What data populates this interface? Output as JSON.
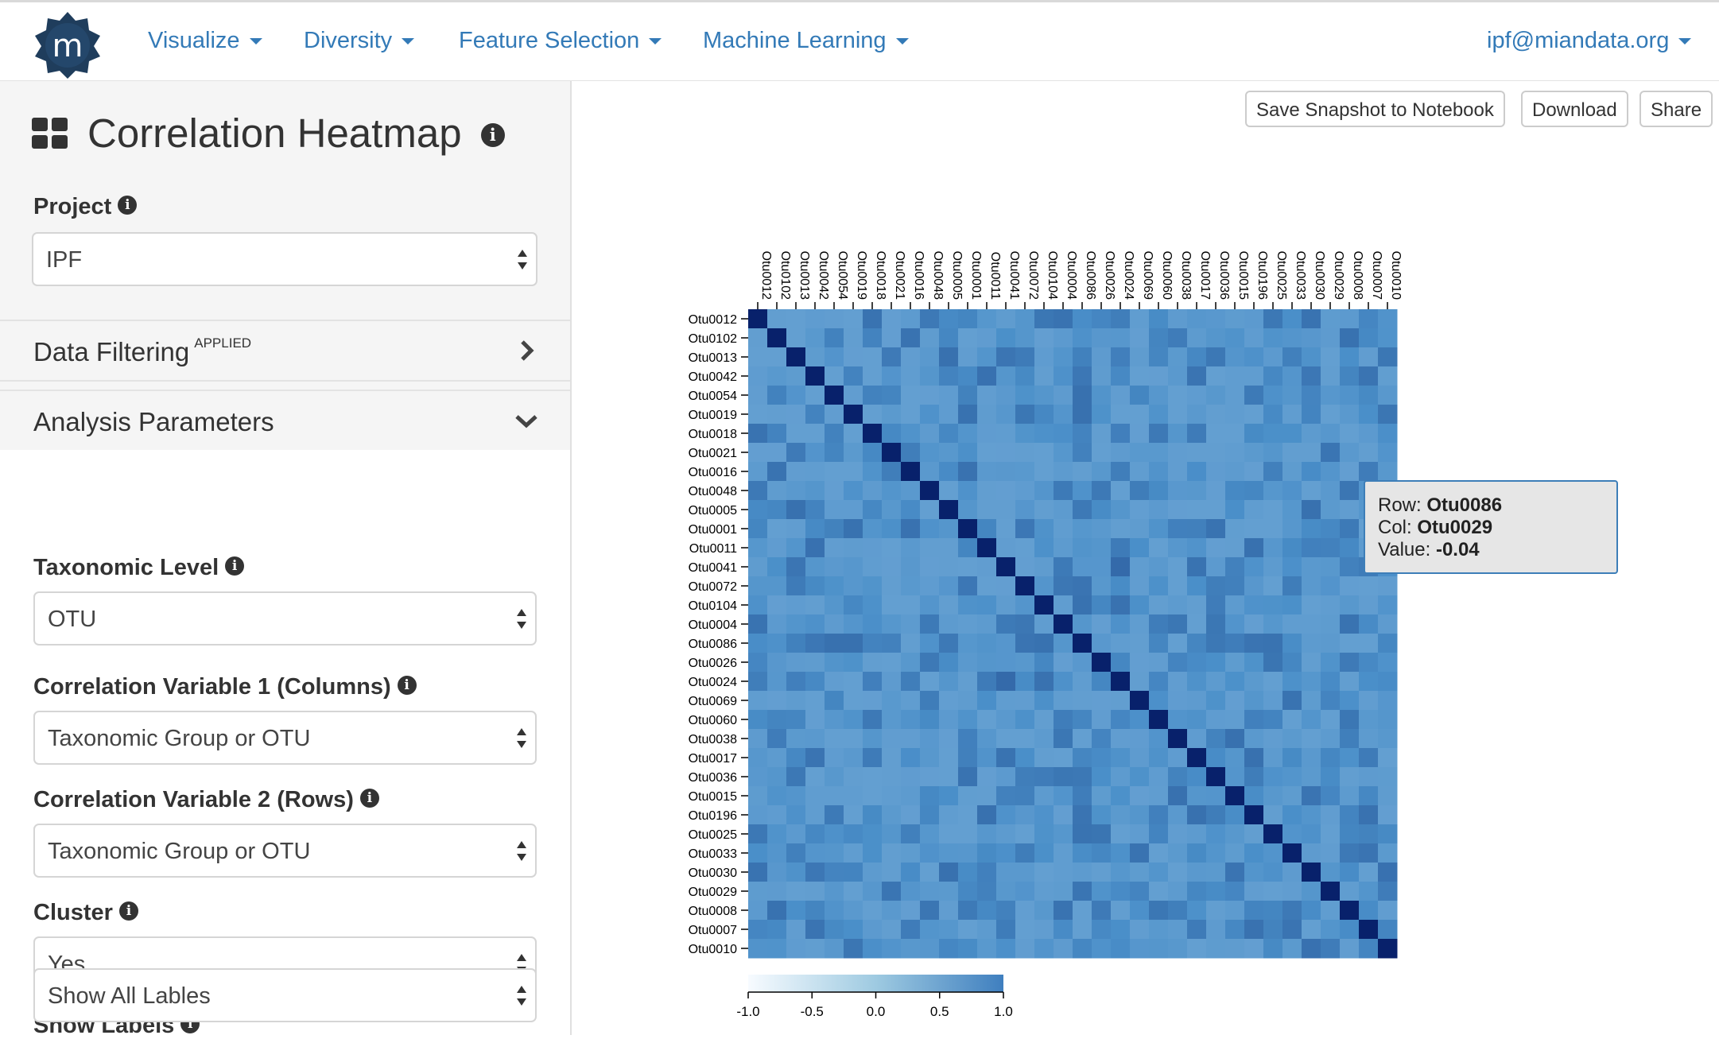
{
  "nav": {
    "items": [
      "Visualize",
      "Diversity",
      "Feature Selection",
      "Machine Learning"
    ],
    "user": "ipf@miandata.org"
  },
  "sidebar": {
    "title": "Correlation Heatmap",
    "project": {
      "label": "Project",
      "value": "IPF"
    },
    "data_filtering": {
      "label": "Data Filtering",
      "badge": "APPLIED"
    },
    "analysis_parameters": {
      "label": "Analysis Parameters"
    },
    "taxonomic_level": {
      "label": "Taxonomic Level",
      "value": "OTU"
    },
    "corr_var1": {
      "label": "Correlation Variable 1 (Columns)",
      "value": "Taxonomic Group or OTU"
    },
    "corr_var2": {
      "label": "Correlation Variable 2 (Rows)",
      "value": "Taxonomic Group or OTU"
    },
    "cluster": {
      "label": "Cluster",
      "value": "Yes"
    },
    "show_labels": {
      "label": "Show Labels",
      "value": "Show All Lables"
    }
  },
  "toolbar": {
    "save_snapshot": "Save Snapshot to Notebook",
    "download": "Download",
    "share": "Share"
  },
  "tooltip": {
    "row_label": "Row:",
    "row_value": "Otu0086",
    "col_label": "Col:",
    "col_value": "Otu0029",
    "value_label": "Value:",
    "value_value": "-0.04"
  },
  "colors": {
    "link": "#337ab7",
    "cell_low": "#f7fbff",
    "cell_mid": "#4a8fc9",
    "cell_high": "#08216b"
  },
  "chart_data": {
    "type": "heatmap",
    "columns": [
      "Otu0012",
      "Otu0102",
      "Otu0013",
      "Otu0042",
      "Otu0054",
      "Otu0019",
      "Otu0018",
      "Otu0021",
      "Otu0016",
      "Otu0048",
      "Otu0005",
      "Otu0001",
      "Otu0011",
      "Otu0041",
      "Otu0072",
      "Otu0104",
      "Otu0004",
      "Otu0086",
      "Otu0026",
      "Otu0024",
      "Otu0069",
      "Otu0060",
      "Otu0038",
      "Otu0017",
      "Otu0036",
      "Otu0015",
      "Otu0196",
      "Otu0025",
      "Otu0033",
      "Otu0030",
      "Otu0029",
      "Otu0008",
      "Otu0007",
      "Otu0010"
    ],
    "rows": [
      "Otu0012",
      "Otu0102",
      "Otu0013",
      "Otu0042",
      "Otu0054",
      "Otu0019",
      "Otu0018",
      "Otu0021",
      "Otu0016",
      "Otu0048",
      "Otu0005",
      "Otu0001",
      "Otu0011",
      "Otu0041",
      "Otu0072",
      "Otu0104",
      "Otu0004",
      "Otu0086",
      "Otu0026",
      "Otu0024",
      "Otu0069",
      "Otu0060",
      "Otu0038",
      "Otu0017",
      "Otu0036",
      "Otu0015",
      "Otu0196",
      "Otu0025",
      "Otu0033",
      "Otu0030",
      "Otu0029",
      "Otu0008",
      "Otu0007",
      "Otu0010"
    ],
    "diagonal_value": 1.0,
    "offdiag_range": [
      -0.1,
      0.35
    ],
    "highlighted": [
      {
        "row": "Otu0086",
        "col": "Otu0029",
        "value": -0.04
      },
      {
        "row": "Otu0041",
        "col": "Otu0024",
        "value": 0.4
      },
      {
        "row": "Otu0024",
        "col": "Otu0041",
        "value": 0.4
      },
      {
        "row": "Otu0012",
        "col": "Otu0104",
        "value": 0.3
      },
      {
        "row": "Otu0019",
        "col": "Otu0072",
        "value": 0.3
      },
      {
        "row": "Otu0013",
        "col": "Otu0010",
        "value": 0.3
      }
    ],
    "colorbar": {
      "ticks": [
        "-1.0",
        "-0.5",
        "0.0",
        "0.5",
        "1.0"
      ],
      "min": -1.0,
      "max": 1.0
    }
  }
}
